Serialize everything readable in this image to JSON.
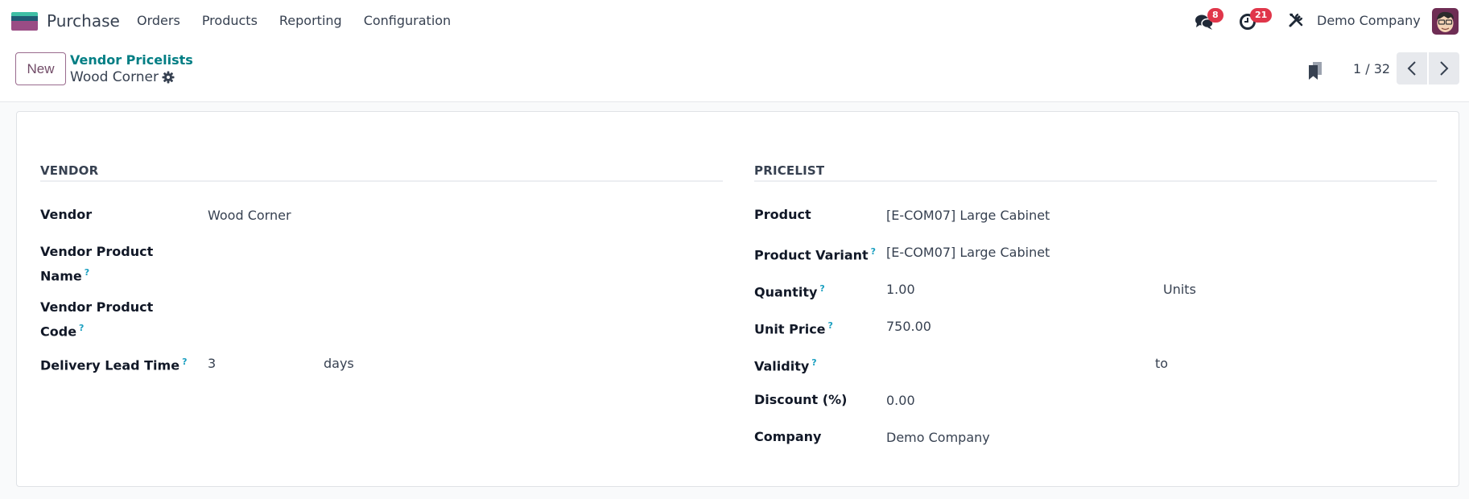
{
  "navbar": {
    "app_name": "Purchase",
    "menu": [
      "Orders",
      "Products",
      "Reporting",
      "Configuration"
    ],
    "messages_badge": "8",
    "activities_badge": "21",
    "company": "Demo Company",
    "icons": {
      "app": "purchase-app-icon",
      "messages": "chat-bubbles-icon",
      "activities": "clock-icon",
      "debug": "tools-icon",
      "avatar": "user-avatar"
    }
  },
  "control_panel": {
    "new_label": "New",
    "breadcrumb_parent": "Vendor Pricelists",
    "record_title": "Wood Corner",
    "pager": "1 / 32"
  },
  "vendor_section": {
    "title": "VENDOR",
    "fields": [
      {
        "label": "Vendor",
        "value": "Wood Corner",
        "help": false
      },
      {
        "label_line1": "Vendor Product",
        "label_line2": "Name",
        "value": "",
        "help": true
      },
      {
        "label_line1": "Vendor Product",
        "label_line2": "Code",
        "value": "",
        "help": true
      },
      {
        "label": "Delivery Lead Time",
        "value": "3",
        "unit": "days",
        "help": true
      }
    ]
  },
  "pricelist_section": {
    "title": "PRICELIST",
    "fields": [
      {
        "label": "Product",
        "value": "[E-COM07] Large Cabinet",
        "help": false
      },
      {
        "label": "Product Variant",
        "value": "[E-COM07] Large Cabinet",
        "help": true
      },
      {
        "label": "Quantity",
        "value": "1.00",
        "unit": "Units",
        "help": true
      },
      {
        "label": "Unit Price",
        "value": "750.00",
        "help": true
      },
      {
        "label": "Validity",
        "value_from": "",
        "separator": "to",
        "value_to": "",
        "help": true
      },
      {
        "label": "Discount (%)",
        "value": "0.00",
        "help": false
      },
      {
        "label": "Company",
        "value": "Demo Company",
        "help": false
      }
    ]
  },
  "help_marker": "?",
  "colors": {
    "brand": "#714b67",
    "link": "#017e84",
    "badge": "#e0364a",
    "help": "#1a9fc0"
  }
}
